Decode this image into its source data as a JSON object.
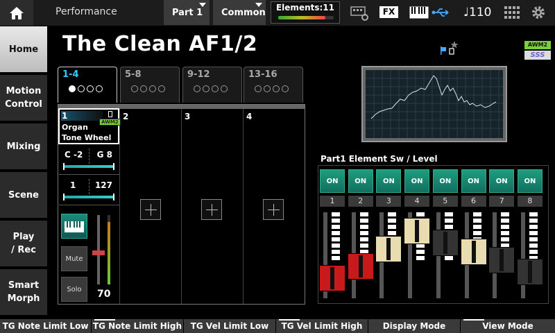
{
  "top_bar": {
    "app_title": "Performance",
    "part_menu": "Part 1",
    "common_menu": "Common",
    "elements_label": "Elements:11",
    "elements_fill": 0.85,
    "fx_label": "FX",
    "tempo": "♩110"
  },
  "sidebar": {
    "items": [
      {
        "label": "Home"
      },
      {
        "label": "Motion\nControl"
      },
      {
        "label": "Mixing"
      },
      {
        "label": "Scene"
      },
      {
        "label": "Play\n/ Rec"
      },
      {
        "label": "Smart\nMorph"
      }
    ]
  },
  "performance": {
    "title": "The Clean AF1/2"
  },
  "part_tabs": [
    {
      "label": "1-4"
    },
    {
      "label": "5-8"
    },
    {
      "label": "9-12"
    },
    {
      "label": "13-16"
    }
  ],
  "parts": {
    "part1": {
      "number": "1",
      "name": "Organ\nTone Wheel",
      "badge": "AWM2",
      "note_low": "C -2",
      "note_high": "G 8",
      "vel_low": "1",
      "vel_high": "127",
      "volume": "70",
      "mute_label": "Mute",
      "solo_label": "Solo"
    },
    "others": [
      {
        "number": "2"
      },
      {
        "number": "3"
      },
      {
        "number": "4"
      }
    ]
  },
  "badges": {
    "awm2": "AWM2",
    "sss": "SSS"
  },
  "element_panel": {
    "title": "Part1 Element Sw / Level",
    "elements": [
      {
        "num": "1",
        "sw": "ON",
        "level": 0.1,
        "cap_color": "#c81a1a"
      },
      {
        "num": "2",
        "sw": "ON",
        "level": 0.3,
        "cap_color": "#c81a1a"
      },
      {
        "num": "3",
        "sw": "ON",
        "level": 0.6,
        "cap_color": "#e8dcb0"
      },
      {
        "num": "4",
        "sw": "ON",
        "level": 0.9,
        "cap_color": "#e8dcb0"
      },
      {
        "num": "5",
        "sw": "ON",
        "level": 0.7,
        "cap_color": "#333333"
      },
      {
        "num": "6",
        "sw": "ON",
        "level": 0.55,
        "cap_color": "#e8dcb0"
      },
      {
        "num": "7",
        "sw": "ON",
        "level": 0.4,
        "cap_color": "#333333"
      },
      {
        "num": "8",
        "sw": "ON",
        "level": 0.2,
        "cap_color": "#333333"
      }
    ]
  },
  "function_bar": [
    {
      "label": "TG Note Limit Low",
      "marked": false
    },
    {
      "label": "TG Note Limit High",
      "marked": true
    },
    {
      "label": "TG Vel Limit Low",
      "marked": false
    },
    {
      "label": "TG Vel Limit High",
      "marked": true
    },
    {
      "label": "Display Mode",
      "marked": false
    },
    {
      "label": "View Mode",
      "marked": true
    }
  ],
  "colors": {
    "accent": "#33ccff",
    "on_button": "#1f9d7e"
  }
}
